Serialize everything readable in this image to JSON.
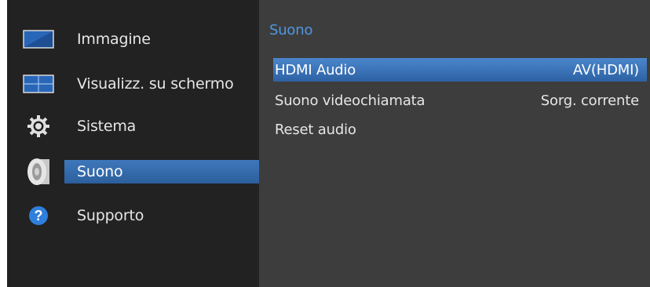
{
  "left_menu": {
    "items": [
      {
        "label": "Immagine",
        "icon": "picture-icon"
      },
      {
        "label": "Visualizz. su schermo",
        "icon": "screen-display-icon"
      },
      {
        "label": "Sistema",
        "icon": "gear-icon"
      },
      {
        "label": "Suono",
        "icon": "speaker-icon",
        "selected": true
      },
      {
        "label": "Supporto",
        "icon": "help-icon"
      }
    ]
  },
  "panel": {
    "title": "Suono",
    "rows": [
      {
        "label": "HDMI Audio",
        "value": "AV(HDMI)",
        "selected": true
      },
      {
        "label": "Suono videochiamata",
        "value": "Sorg. corrente"
      },
      {
        "label": "Reset audio",
        "value": ""
      }
    ]
  },
  "colors": {
    "accent": "#3e78bb",
    "title_blue": "#4f97e3",
    "background": "#222222",
    "panel": "#3d3d3d"
  }
}
